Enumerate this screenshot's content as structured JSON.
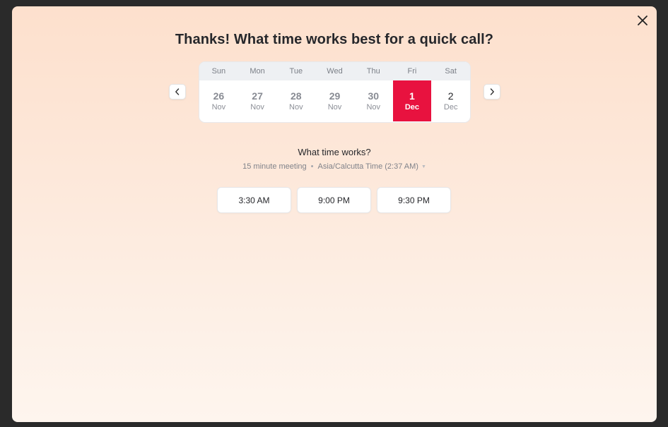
{
  "title": "Thanks! What time works best for a quick call?",
  "close_icon": "close-icon",
  "calendar": {
    "prev_icon": "chevron-left-icon",
    "next_icon": "chevron-right-icon",
    "weekdays": [
      "Sun",
      "Mon",
      "Tue",
      "Wed",
      "Thu",
      "Fri",
      "Sat"
    ],
    "days": [
      {
        "num": "26",
        "mon": "Nov",
        "state": "past"
      },
      {
        "num": "27",
        "mon": "Nov",
        "state": "past"
      },
      {
        "num": "28",
        "mon": "Nov",
        "state": "past"
      },
      {
        "num": "29",
        "mon": "Nov",
        "state": "past"
      },
      {
        "num": "30",
        "mon": "Nov",
        "state": "past"
      },
      {
        "num": "1",
        "mon": "Dec",
        "state": "selected"
      },
      {
        "num": "2",
        "mon": "Dec",
        "state": "future"
      }
    ],
    "selected_color": "#e8123f"
  },
  "schedule": {
    "heading": "What time works?",
    "duration": "15 minute meeting",
    "timezone": "Asia/Calcutta Time (2:37 AM)"
  },
  "slots": [
    "3:30 AM",
    "9:00 PM",
    "9:30 PM"
  ]
}
